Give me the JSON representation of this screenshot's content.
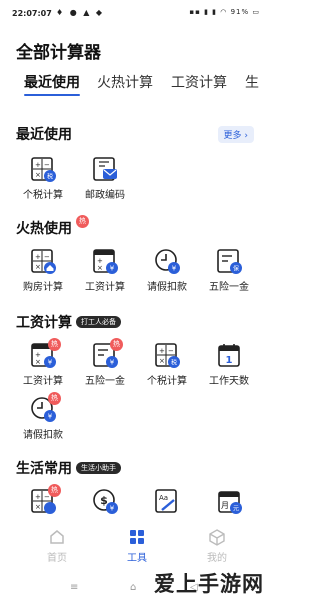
{
  "status": {
    "time": "22:07:07",
    "battery": "91%"
  },
  "header": {
    "title": "全部计算器"
  },
  "tabs": [
    "最近使用",
    "火热计算",
    "工资计算",
    "生"
  ],
  "sections": {
    "recent": {
      "title": "最近使用",
      "more": "更多"
    },
    "hot": {
      "title": "火热使用",
      "hot_mark": "热"
    },
    "salary": {
      "title": "工资计算",
      "badge": "打工人必备"
    },
    "life": {
      "title": "生活常用",
      "badge": "生活小助手"
    }
  },
  "recent_items": [
    "个税计算",
    "邮政编码"
  ],
  "hot_items": [
    "购房计算",
    "工资计算",
    "请假扣款",
    "五险一金"
  ],
  "salary_items": [
    "工资计算",
    "五险一金",
    "个税计算",
    "工作天数",
    "请假扣款"
  ],
  "icon_marks": {
    "tax": "税",
    "money": "¥",
    "insurance": "保",
    "hot": "热",
    "day": "1",
    "month": "月",
    "yuan": "元"
  },
  "bottom_nav": [
    "首页",
    "工具",
    "我的"
  ],
  "watermark": "爱上手游网",
  "colors": {
    "accent": "#2b5fd9",
    "hot": "#f05c5c"
  }
}
